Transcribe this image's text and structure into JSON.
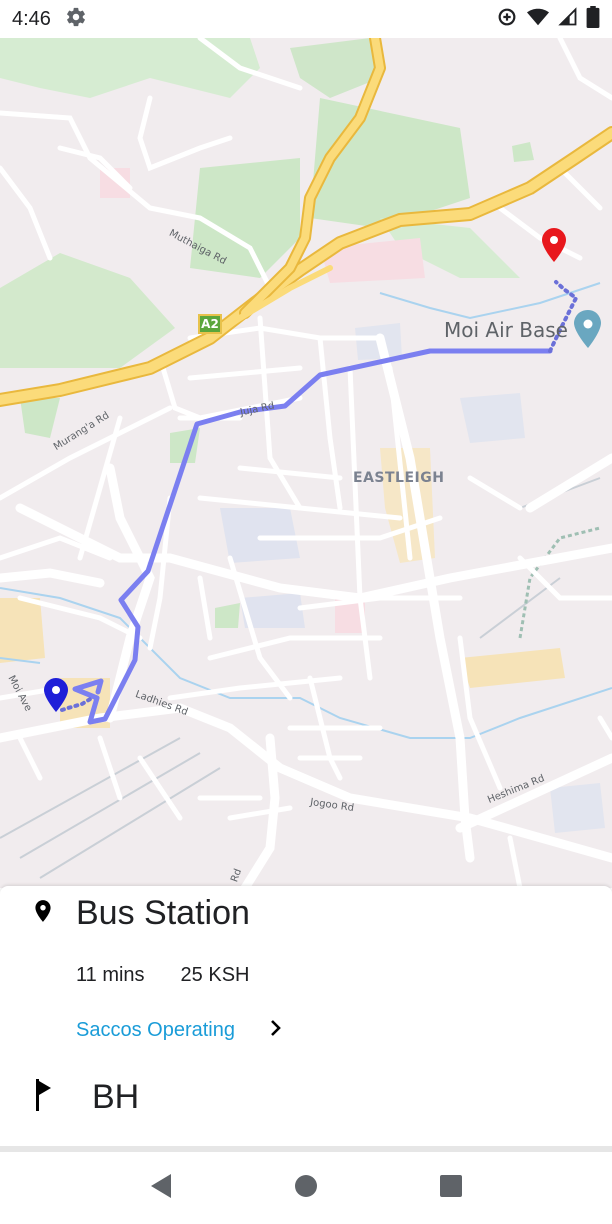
{
  "status_bar": {
    "time": "4:46",
    "icons": [
      "settings-icon",
      "data-saver-icon",
      "wifi-icon",
      "signal-icon",
      "battery-icon"
    ]
  },
  "map": {
    "labels": {
      "moi_air_base": "Moi Air Base",
      "eastleigh": "EASTLEIGH",
      "muthaiga_rd": "Muthaiga Rd",
      "juja_rd": "Juja Rd",
      "muranga_rd": "Murang'a Rd",
      "ladhies_rd": "Ladhies Rd",
      "moi_ave": "Moi Ave",
      "jogoo_rd": "Jogoo Rd",
      "heshima_rd": "Heshima Rd",
      "rd_fragment": "Rd",
      "highway_shield": "A2"
    },
    "route_color": "#7b7ff0",
    "origin_marker_color": "#1f1fd8",
    "destination_marker_color": "#e8171c"
  },
  "route_sheet": {
    "origin": "Bus Station",
    "duration": "11 mins",
    "fare": "25 KSH",
    "saccos_link": "Saccos Operating",
    "destination": "BH",
    "link_color": "#1a9cd8"
  },
  "nav_bar": {
    "buttons": [
      "back-icon",
      "home-icon",
      "recents-icon"
    ]
  }
}
